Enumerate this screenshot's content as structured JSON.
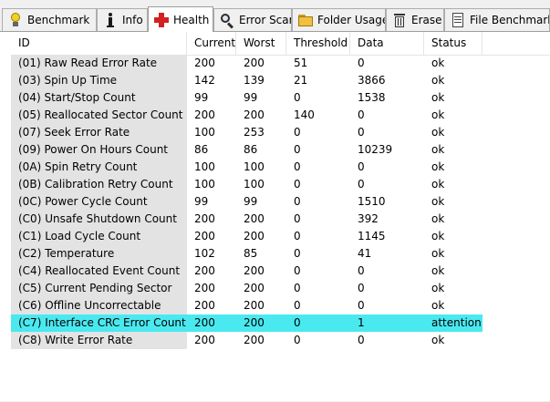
{
  "tabs": [
    {
      "label": "Benchmark",
      "icon": "lightbulb-icon",
      "active": false
    },
    {
      "label": "Info",
      "icon": "info-icon",
      "active": false
    },
    {
      "label": "Health",
      "icon": "red-cross-icon",
      "active": true
    },
    {
      "label": "Error Scan",
      "icon": "magnifier-icon",
      "active": false
    },
    {
      "label": "Folder Usage",
      "icon": "folder-icon",
      "active": false
    },
    {
      "label": "Erase",
      "icon": "trash-icon",
      "active": false
    },
    {
      "label": "File Benchmark",
      "icon": "document-icon",
      "active": false
    }
  ],
  "table": {
    "columns": [
      "ID",
      "Current",
      "Worst",
      "Threshold",
      "Data",
      "Status"
    ],
    "rows": [
      {
        "id": "(01) Raw Read Error Rate",
        "current": "200",
        "worst": "200",
        "threshold": "51",
        "data": "0",
        "status": "ok"
      },
      {
        "id": "(03) Spin Up Time",
        "current": "142",
        "worst": "139",
        "threshold": "21",
        "data": "3866",
        "status": "ok"
      },
      {
        "id": "(04) Start/Stop Count",
        "current": "99",
        "worst": "99",
        "threshold": "0",
        "data": "1538",
        "status": "ok"
      },
      {
        "id": "(05) Reallocated Sector Count",
        "current": "200",
        "worst": "200",
        "threshold": "140",
        "data": "0",
        "status": "ok"
      },
      {
        "id": "(07) Seek Error Rate",
        "current": "100",
        "worst": "253",
        "threshold": "0",
        "data": "0",
        "status": "ok"
      },
      {
        "id": "(09) Power On Hours Count",
        "current": "86",
        "worst": "86",
        "threshold": "0",
        "data": "10239",
        "status": "ok"
      },
      {
        "id": "(0A) Spin Retry Count",
        "current": "100",
        "worst": "100",
        "threshold": "0",
        "data": "0",
        "status": "ok"
      },
      {
        "id": "(0B) Calibration Retry Count",
        "current": "100",
        "worst": "100",
        "threshold": "0",
        "data": "0",
        "status": "ok"
      },
      {
        "id": "(0C) Power Cycle Count",
        "current": "99",
        "worst": "99",
        "threshold": "0",
        "data": "1510",
        "status": "ok"
      },
      {
        "id": "(C0) Unsafe Shutdown Count",
        "current": "200",
        "worst": "200",
        "threshold": "0",
        "data": "392",
        "status": "ok"
      },
      {
        "id": "(C1) Load Cycle Count",
        "current": "200",
        "worst": "200",
        "threshold": "0",
        "data": "1145",
        "status": "ok"
      },
      {
        "id": "(C2) Temperature",
        "current": "102",
        "worst": "85",
        "threshold": "0",
        "data": "41",
        "status": "ok"
      },
      {
        "id": "(C4) Reallocated Event Count",
        "current": "200",
        "worst": "200",
        "threshold": "0",
        "data": "0",
        "status": "ok"
      },
      {
        "id": "(C5) Current Pending Sector",
        "current": "200",
        "worst": "200",
        "threshold": "0",
        "data": "0",
        "status": "ok"
      },
      {
        "id": "(C6) Offline Uncorrectable",
        "current": "200",
        "worst": "200",
        "threshold": "0",
        "data": "0",
        "status": "ok"
      },
      {
        "id": "(C7) Interface CRC Error Count",
        "current": "200",
        "worst": "200",
        "threshold": "0",
        "data": "1",
        "status": "attention"
      },
      {
        "id": "(C8) Write Error Rate",
        "current": "200",
        "worst": "200",
        "threshold": "0",
        "data": "0",
        "status": "ok"
      }
    ]
  },
  "colors": {
    "attention_highlight": "#4ae9f0",
    "id_column_bg": "#e3e3e3",
    "health_icon": "#d42020"
  }
}
